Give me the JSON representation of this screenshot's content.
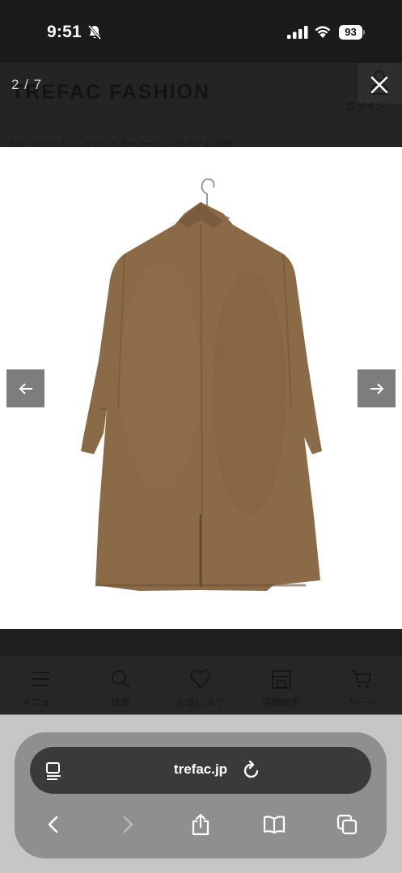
{
  "status_bar": {
    "time": "9:51",
    "battery": "93",
    "icons": [
      "bell-off-icon",
      "signal-icon",
      "wifi-icon",
      "battery-icon"
    ]
  },
  "site": {
    "logo": "TREFAC FASHION",
    "login_label": "ログイン",
    "breadcrumb": "TOP ＞ コート ＞ ステンカラーコート ＞ ライテル 詳細",
    "bottom_nav": [
      {
        "label": "メニュー",
        "icon": "menu-icon"
      },
      {
        "label": "検索",
        "icon": "search-icon"
      },
      {
        "label": "お気に入り",
        "icon": "heart-icon"
      },
      {
        "label": "店舗検索",
        "icon": "store-icon"
      },
      {
        "label": "カート",
        "icon": "cart-icon"
      }
    ]
  },
  "gallery": {
    "counter": "2 / 7",
    "image_subject": "coat-back-view",
    "coat_color": "#8a6a47",
    "prev_icon": "arrow-left-icon",
    "next_icon": "arrow-right-icon",
    "close_icon": "close-icon"
  },
  "browser": {
    "url": "trefac.jp",
    "toolbar_icons": [
      "back-icon",
      "forward-icon",
      "share-icon",
      "bookmarks-icon",
      "tabs-icon"
    ]
  }
}
